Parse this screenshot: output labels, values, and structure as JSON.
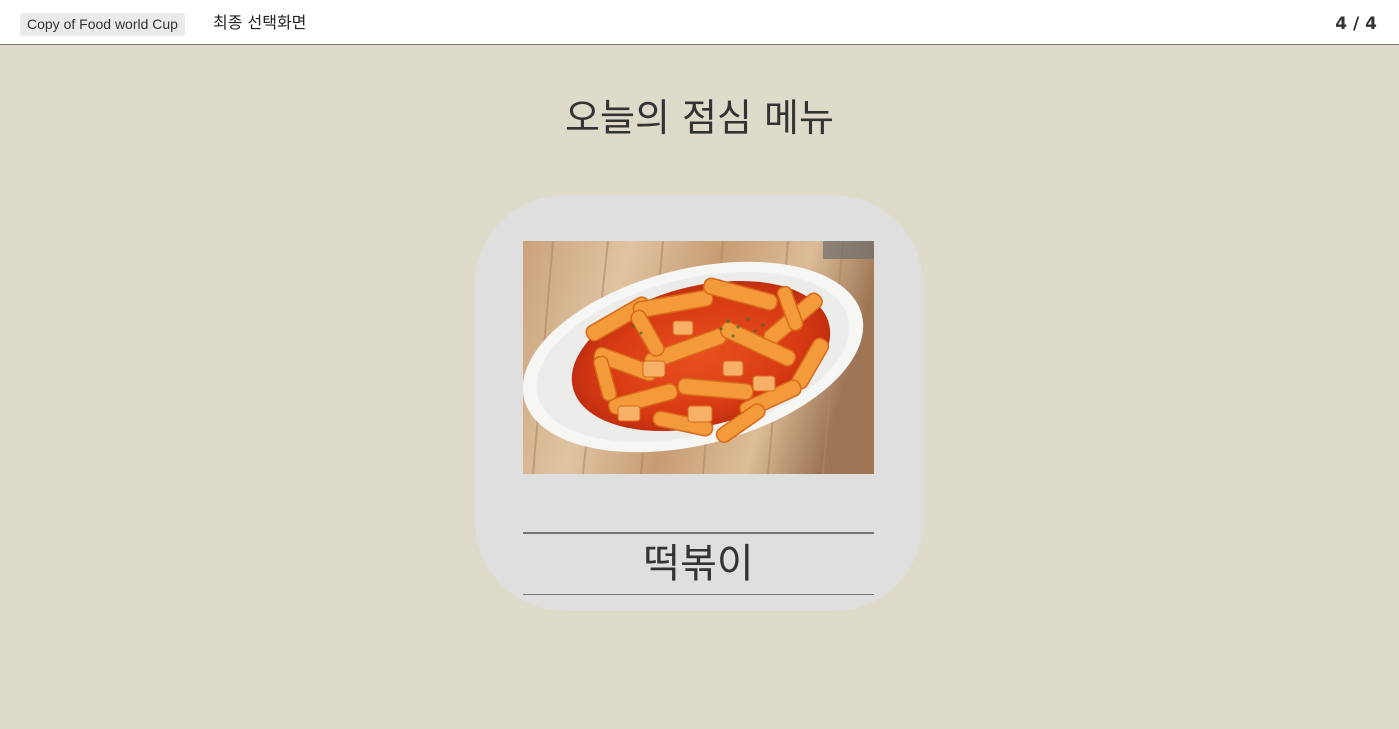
{
  "header": {
    "project_name": "Copy of Food world Cup",
    "screen_name": "최종 선택화면",
    "page_counter": "4 / 4"
  },
  "main": {
    "title": "오늘의 점심 메뉴",
    "result": {
      "food_name": "떡볶이",
      "image_icon": "tteokbokki-photo"
    }
  },
  "colors": {
    "background": "#dfdbcb",
    "card": "#dfdfdf",
    "text": "#333333"
  }
}
